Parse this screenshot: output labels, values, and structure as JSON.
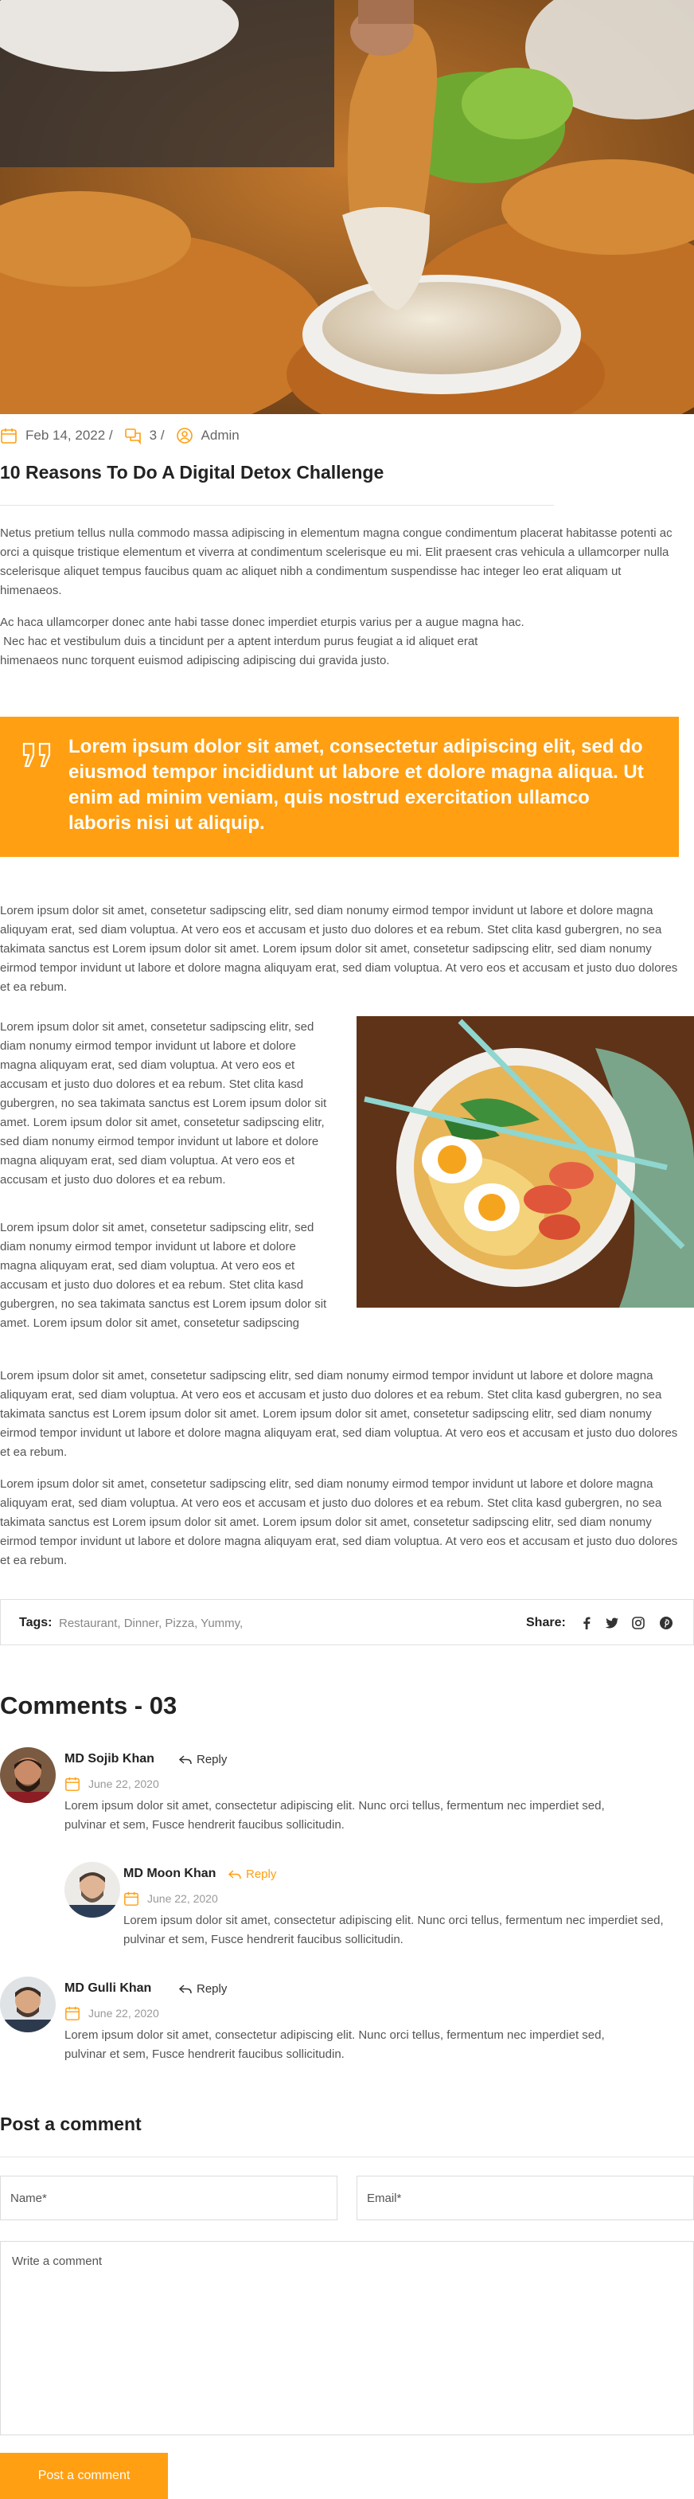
{
  "post": {
    "meta": {
      "date": "Feb 14, 2022 /",
      "comments": "3 /",
      "author": "Admin"
    },
    "title": "10 Reasons To Do A Digital Detox Challenge",
    "paragraph1": "Netus pretium tellus nulla commodo massa adipiscing in elementum magna congue condimentum placerat habitasse potenti ac orci a quisque tristique elementum et viverra at condimentum scelerisque eu mi. Elit praesent cras vehicula a ullamcorper nulla scelerisque aliquet tempus faucibus quam ac aliquet nibh a condimentum suspendisse hac integer leo erat aliquam ut himenaeos.",
    "paragraph2_line1": "Ac haca ullamcorper donec ante habi tasse donec imperdiet eturpis varius per a augue magna hac.",
    "paragraph2_line2": " Nec hac et vestibulum duis a tincidunt per a aptent interdum purus feugiat a id aliquet erat",
    "paragraph2_line3": "himenaeos nunc torquent euismod adipiscing adipiscing dui gravida justo.",
    "quote": "Lorem ipsum dolor sit amet, consectetur adipiscing elit, sed do eiusmod tempor incididunt ut labore et dolore magna aliqua. Ut enim ad minim veniam, quis nostrud exercitation ullamco laboris nisi ut aliquip.",
    "paragraph3": "Lorem ipsum dolor sit amet, consetetur sadipscing elitr, sed diam nonumy eirmod tempor invidunt ut labore et dolore magna aliquyam erat, sed diam voluptua. At vero eos et accusam et justo duo dolores et ea rebum. Stet clita kasd gubergren, no sea takimata sanctus est Lorem ipsum dolor sit amet. Lorem ipsum dolor sit amet, consetetur sadipscing elitr, sed diam nonumy eirmod tempor invidunt ut labore et dolore magna aliquyam erat, sed diam voluptua. At vero eos et accusam et justo duo dolores et ea rebum.",
    "side_paragraph1": "Lorem ipsum dolor sit amet, consetetur sadipscing elitr, sed diam nonumy eirmod tempor invidunt ut labore et dolore magna aliquyam erat, sed diam voluptua. At vero eos et accusam et justo duo dolores et ea rebum. Stet clita kasd gubergren, no sea takimata sanctus est Lorem ipsum dolor sit amet. Lorem ipsum dolor sit amet, consetetur sadipscing elitr, sed diam nonumy eirmod tempor invidunt ut labore et dolore magna aliquyam erat, sed diam voluptua. At vero eos et accusam et justo duo dolores et ea rebum.",
    "side_paragraph2": "Lorem ipsum dolor sit amet, consetetur sadipscing elitr, sed diam nonumy eirmod tempor invidunt ut labore et dolore magna aliquyam erat, sed diam voluptua. At vero eos et accusam et justo duo dolores et ea rebum. Stet clita kasd gubergren, no sea takimata sanctus est Lorem ipsum dolor sit amet. Lorem ipsum dolor sit amet, consetetur sadipscing",
    "paragraph4": "Lorem ipsum dolor sit amet, consetetur sadipscing elitr, sed diam nonumy eirmod tempor invidunt ut labore et dolore magna aliquyam erat, sed diam voluptua. At vero eos et accusam et justo duo dolores et ea rebum. Stet clita kasd gubergren, no sea takimata sanctus est Lorem ipsum dolor sit amet. Lorem ipsum dolor sit amet, consetetur sadipscing elitr, sed diam nonumy eirmod tempor invidunt ut labore et dolore magna aliquyam erat, sed diam voluptua. At vero eos et accusam et justo duo dolores et ea rebum.",
    "paragraph5": "Lorem ipsum dolor sit amet, consetetur sadipscing elitr, sed diam nonumy eirmod tempor invidunt ut labore et dolore magna aliquyam erat, sed diam voluptua. At vero eos et accusam et justo duo dolores et ea rebum. Stet clita kasd gubergren, no sea takimata sanctus est Lorem ipsum dolor sit amet. Lorem ipsum dolor sit amet, consetetur sadipscing elitr, sed diam nonumy eirmod tempor invidunt ut labore et dolore magna aliquyam erat, sed diam voluptua. At vero eos et accusam et justo duo dolores et ea rebum."
  },
  "tags": {
    "label": "Tags:",
    "values": "Restaurant, Dinner, Pizza, Yummy,",
    "share_label": "Share:",
    "social_icons": [
      "facebook-icon",
      "twitter-icon",
      "instagram-icon",
      "pinterest-icon"
    ]
  },
  "comments": {
    "title": "Comments - 03",
    "items": [
      {
        "name": "MD Sojib Khan",
        "reply": "Reply",
        "date": "June 22, 2020",
        "body": "Lorem ipsum dolor sit amet, consectetur adipiscing elit. Nunc orci tellus, fermentum nec imperdiet sed, pulvinar et sem, Fusce hendrerit faucibus sollicitudin."
      },
      {
        "name": "MD Moon Khan",
        "reply": "Reply",
        "date": "June 22, 2020",
        "body": "Lorem ipsum dolor sit amet, consectetur adipiscing elit. Nunc orci tellus, fermentum nec imperdiet sed, pulvinar et sem, Fusce hendrerit faucibus sollicitudin."
      },
      {
        "name": "MD Gulli Khan",
        "reply": "Reply",
        "date": "June 22, 2020",
        "body": "Lorem ipsum dolor sit amet, consectetur adipiscing elit. Nunc orci tellus, fermentum nec imperdiet sed, pulvinar et sem, Fusce hendrerit faucibus sollicitudin."
      }
    ]
  },
  "form": {
    "title": "Post a comment",
    "name_placeholder": "Name*",
    "email_placeholder": "Email*",
    "comment_placeholder": "Write a comment",
    "submit_label": "Post a comment"
  },
  "colors": {
    "accent": "#ff9f11",
    "heading": "#222222",
    "text": "#555555"
  }
}
